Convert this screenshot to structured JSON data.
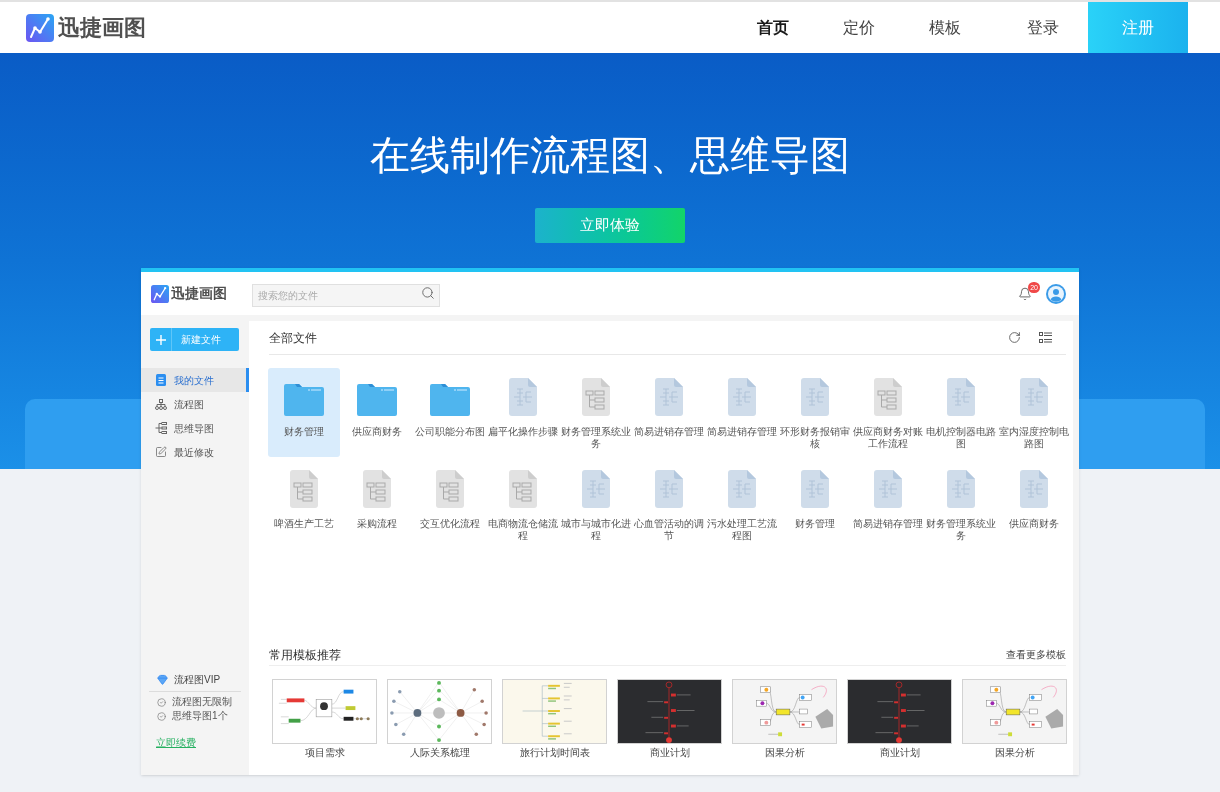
{
  "nav": {
    "logo": "迅捷画图",
    "links": [
      {
        "label": "首页",
        "selected": true
      },
      {
        "label": "定价",
        "selected": false
      },
      {
        "label": "模板",
        "selected": false
      }
    ],
    "login": "登录",
    "register": "注册"
  },
  "hero": {
    "title": "在线制作流程图、思维导图",
    "cta": "立即体验"
  },
  "app": {
    "logo": "迅捷画图",
    "search": {
      "placeholder": "搜索您的文件"
    },
    "notifications": {
      "badge": "20"
    },
    "sidebar": {
      "new_file": "新建文件",
      "items": [
        {
          "kind": "files",
          "label": "我的文件",
          "selected": true
        },
        {
          "kind": "flowchart",
          "label": "流程图",
          "selected": false
        },
        {
          "kind": "mindmap",
          "label": "思维导图",
          "selected": false
        },
        {
          "kind": "recent",
          "label": "最近修改",
          "selected": false
        }
      ],
      "plan": {
        "title": "流程图VIP",
        "features": [
          "流程图无限制",
          "思维导图1个"
        ],
        "renew": "立即续费"
      }
    },
    "files": {
      "title": "全部文件",
      "items": [
        {
          "kind": "folder",
          "name": "财务管理",
          "selected": true
        },
        {
          "kind": "folder",
          "name": "供应商财务",
          "selected": false
        },
        {
          "kind": "folder",
          "name": "公司职能分布图",
          "selected": false
        },
        {
          "kind": "mindmap",
          "name": "扁平化操作步骤",
          "selected": false
        },
        {
          "kind": "flowchart",
          "name": "财务管理系统业务",
          "selected": false
        },
        {
          "kind": "mindmap",
          "name": "简易进销存管理",
          "selected": false
        },
        {
          "kind": "mindmap",
          "name": "简易进销存管理",
          "selected": false
        },
        {
          "kind": "mindmap",
          "name": "环形财务报销审核",
          "selected": false
        },
        {
          "kind": "flowchart",
          "name": "供应商财务对账工作流程",
          "selected": false
        },
        {
          "kind": "mindmap",
          "name": "电机控制器电路图",
          "selected": false
        },
        {
          "kind": "mindmap",
          "name": "室内湿度控制电路图",
          "selected": false
        },
        {
          "kind": "flowchart",
          "name": "啤酒生产工艺",
          "selected": false
        },
        {
          "kind": "flowchart",
          "name": "采购流程",
          "selected": false
        },
        {
          "kind": "flowchart",
          "name": "交互优化流程",
          "selected": false
        },
        {
          "kind": "flowchart",
          "name": "电商物流仓储流程",
          "selected": false
        },
        {
          "kind": "mindmap",
          "name": "城市与城市化进程",
          "selected": false
        },
        {
          "kind": "mindmap",
          "name": "心血管活动的调节",
          "selected": false
        },
        {
          "kind": "mindmap",
          "name": "污水处理工艺流程图",
          "selected": false
        },
        {
          "kind": "mindmap",
          "name": "财务管理",
          "selected": false
        },
        {
          "kind": "mindmap",
          "name": "简易进销存管理",
          "selected": false
        },
        {
          "kind": "mindmap",
          "name": "财务管理系统业务",
          "selected": false
        },
        {
          "kind": "mindmap",
          "name": "供应商财务",
          "selected": false
        }
      ]
    },
    "templates": {
      "title": "常用模板推荐",
      "more": "查看更多模板",
      "items": [
        {
          "kind": "mindmap",
          "name": "项目需求"
        },
        {
          "kind": "network",
          "name": "人际关系梳理"
        },
        {
          "kind": "timeline",
          "name": "旅行计划时间表"
        },
        {
          "kind": "dark-timeline",
          "name": "商业计划"
        },
        {
          "kind": "cause",
          "name": "因果分析"
        },
        {
          "kind": "dark-timeline",
          "name": "商业计划"
        },
        {
          "kind": "cause",
          "name": "因果分析"
        }
      ]
    }
  }
}
